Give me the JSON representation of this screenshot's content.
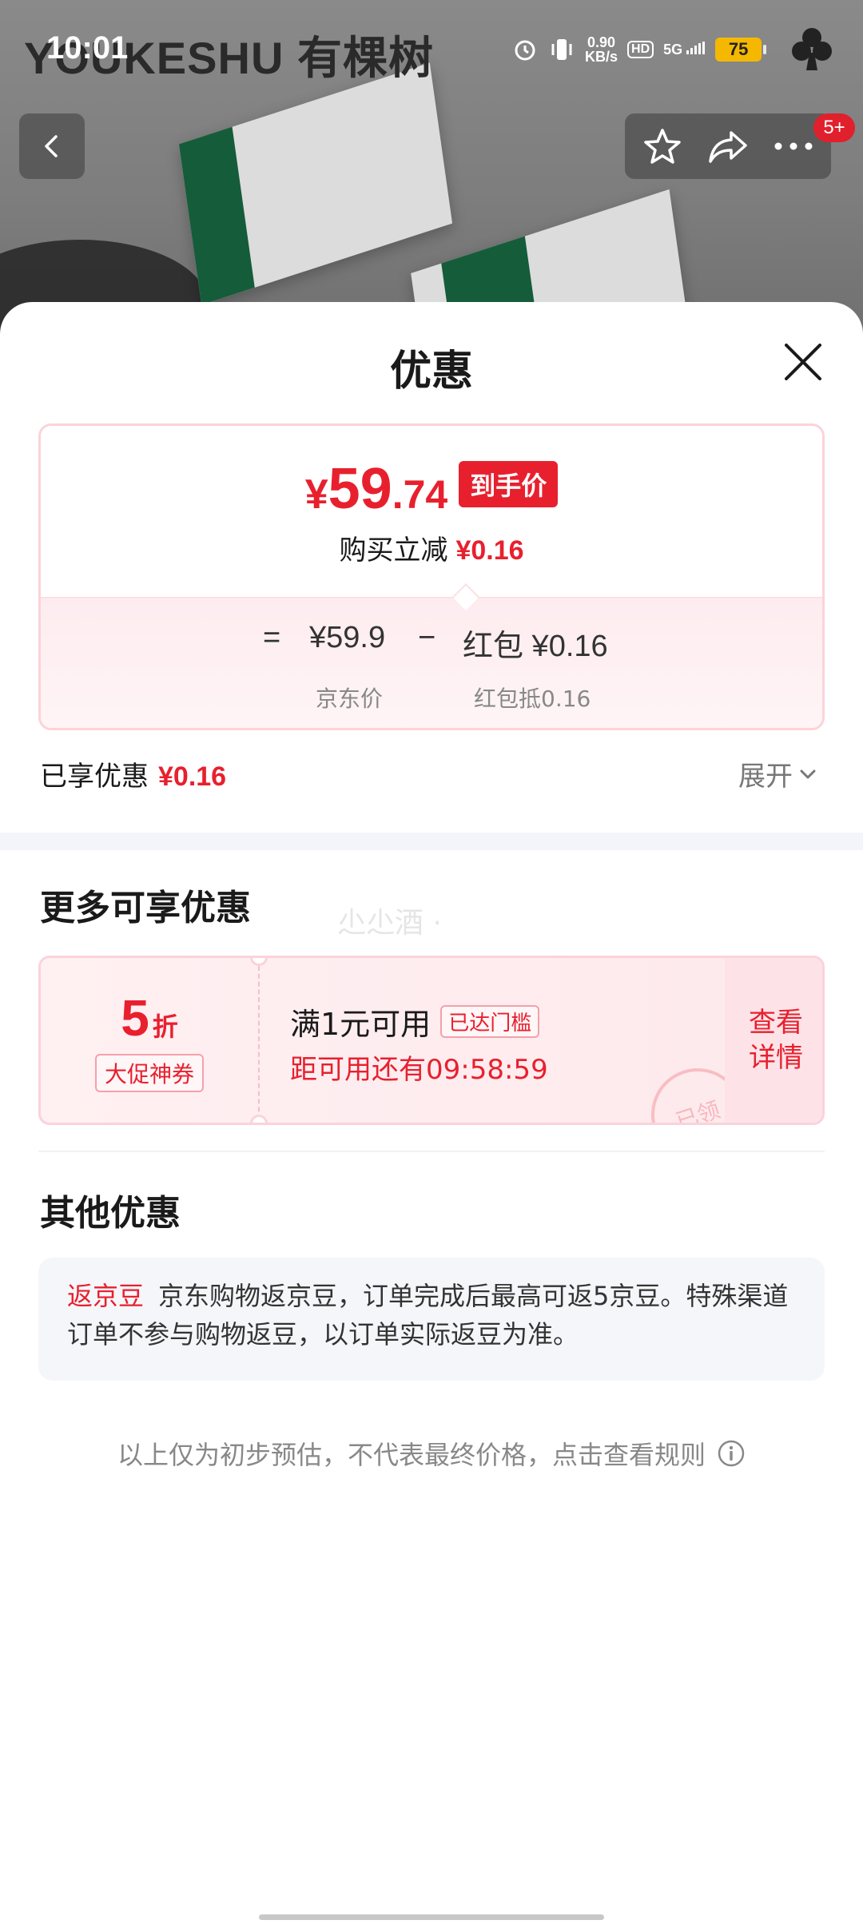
{
  "status_bar": {
    "time": "10:01",
    "net_speed_value": "0.90",
    "net_speed_unit": "KB/s",
    "hd": "HD",
    "signal": "5G",
    "battery": "75"
  },
  "header": {
    "brand_text": "YOUKESHU 有棵树",
    "messages_badge": "5+"
  },
  "sheet": {
    "title": "优惠",
    "price": {
      "yen": "¥",
      "int": "59",
      "dec": ".74",
      "tag": "到手价",
      "sub_label": "购买立减",
      "sub_value": "¥0.16",
      "eq": "=",
      "jd_price": "¥59.9",
      "minus": "−",
      "hongbao": "红包 ¥0.16",
      "jd_label": "京东价",
      "hongbao_label": "红包抵0.16"
    },
    "enjoyed_label": "已享优惠",
    "enjoyed_value": "¥0.16",
    "expand_label": "展开",
    "more_title": "更多可享优惠",
    "watermark": "尐尐酒 ·",
    "coupon": {
      "discount": "5",
      "discount_unit": "折",
      "type": "大促神券",
      "condition": "满1元可用",
      "reached": "已达门槛",
      "countdown": "距可用还有09:58:59",
      "action_line1": "查看",
      "action_line2": "详情",
      "stamp": "已领"
    },
    "other_title": "其他优惠",
    "other": {
      "tag": "返京豆",
      "text": "京东购物返京豆，订单完成后最高可返5京豆。特殊渠道订单不参与购物返豆，以订单实际返豆为准。"
    },
    "footnote": "以上仅为初步预估，不代表最终价格，点击查看规则"
  },
  "colors": {
    "accent_red": "#e8202e",
    "brand_green": "#155c3a",
    "battery": "#f5b800"
  }
}
